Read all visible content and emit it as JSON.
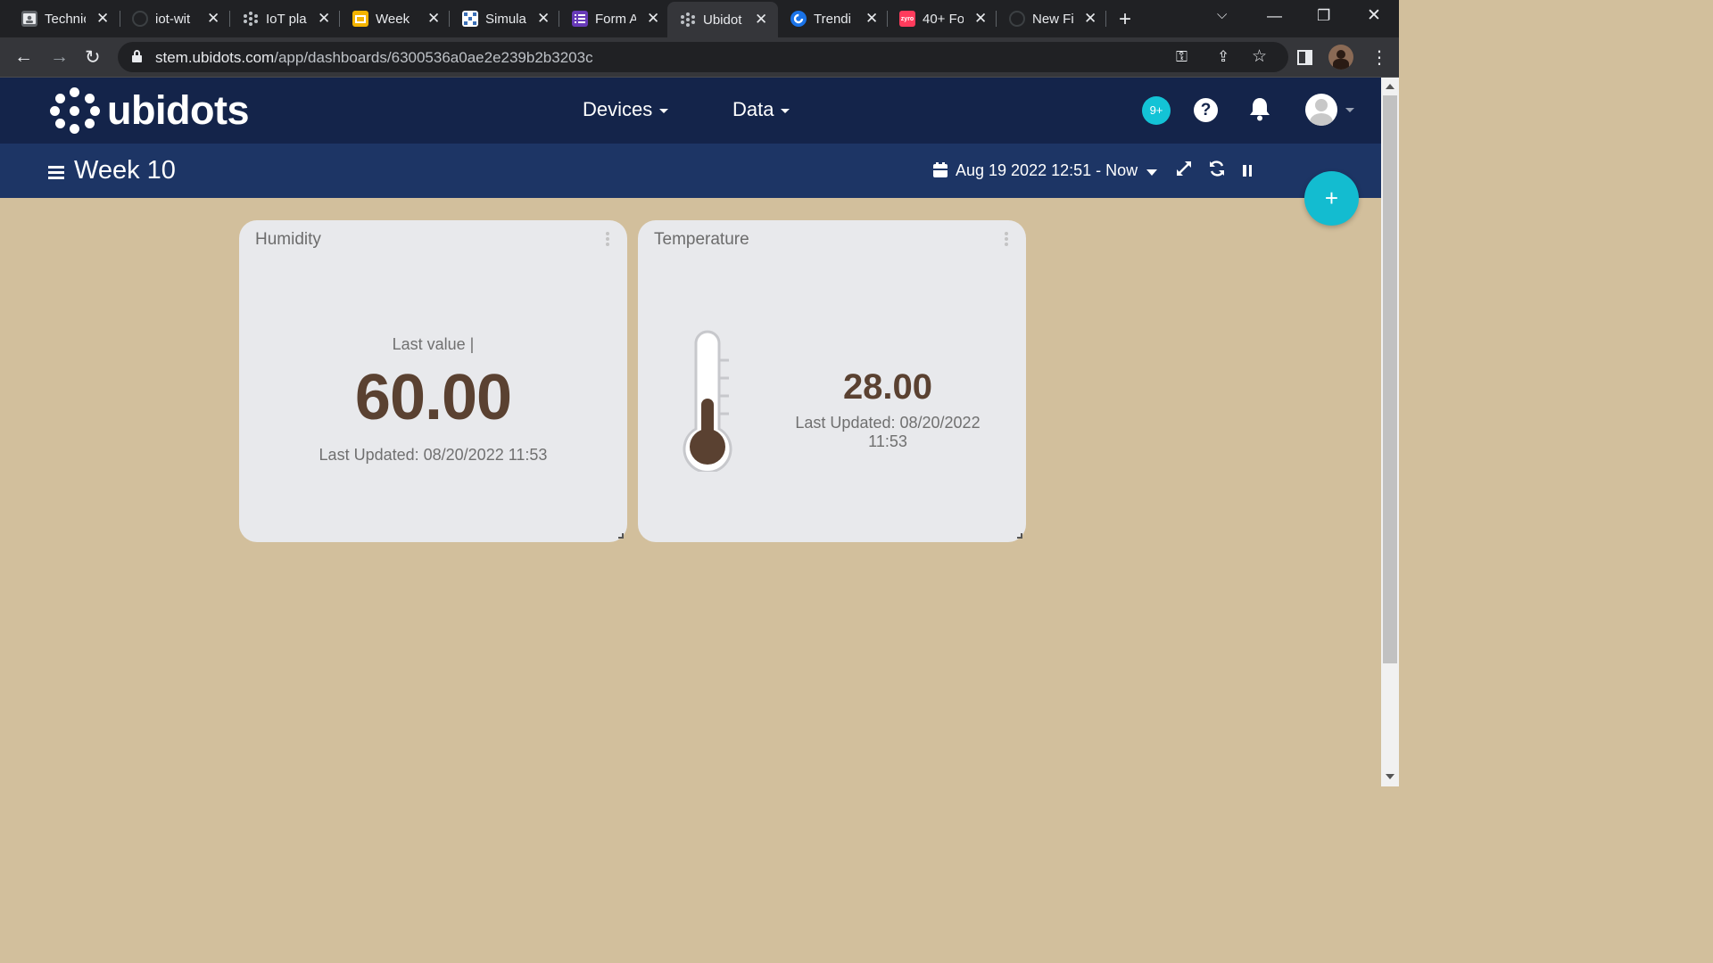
{
  "browser": {
    "tabs": [
      {
        "title": "Technic",
        "favicon": "person-card-icon",
        "color": "#3c4043"
      },
      {
        "title": "iot-wit",
        "favicon": "github-icon",
        "color": "#202124"
      },
      {
        "title": "IoT pla",
        "favicon": "ubidots-icon",
        "color": "#3c4043"
      },
      {
        "title": "Week",
        "favicon": "slides-icon",
        "color": "#f4b400"
      },
      {
        "title": "Simula",
        "favicon": "grid-icon",
        "color": "#ffffff"
      },
      {
        "title": "Form A",
        "favicon": "forms-icon",
        "color": "#673ab7"
      },
      {
        "title": "Ubidot",
        "favicon": "ubidots-icon",
        "color": "#35363a"
      },
      {
        "title": "Trendi",
        "favicon": "c-icon",
        "color": "#1a73e8"
      },
      {
        "title": "40+ Fo",
        "favicon": "zyro-icon",
        "color": "#ff3b5c"
      },
      {
        "title": "New Fi",
        "favicon": "github-icon",
        "color": "#202124"
      }
    ],
    "active_tab_index": 6,
    "url_host": "stem.ubidots.com",
    "url_path": "/app/dashboards/6300536a0ae2e239b2b3203c",
    "favicon_badge_zyro": "zyro"
  },
  "header": {
    "logo_text": "ubidots",
    "nav": {
      "devices": "Devices",
      "data": "Data"
    },
    "notification_badge": "9+",
    "help_glyph": "?"
  },
  "dashboard": {
    "title": "Week 10",
    "date_range": "Aug 19 2022 12:51 - Now",
    "add_glyph": "+"
  },
  "widgets": {
    "humidity": {
      "title": "Humidity",
      "last_value_label": "Last value |",
      "value": "60.00",
      "updated": "Last Updated: 08/20/2022 11:53"
    },
    "temperature": {
      "title": "Temperature",
      "value": "28.00",
      "updated": "Last Updated: 08/20/2022 11:53"
    }
  },
  "colors": {
    "background": "#d2bf9c",
    "navbar": "#14244a",
    "dashbar": "#1d3565",
    "accent": "#13bcd0",
    "value_text": "#5a4131"
  }
}
